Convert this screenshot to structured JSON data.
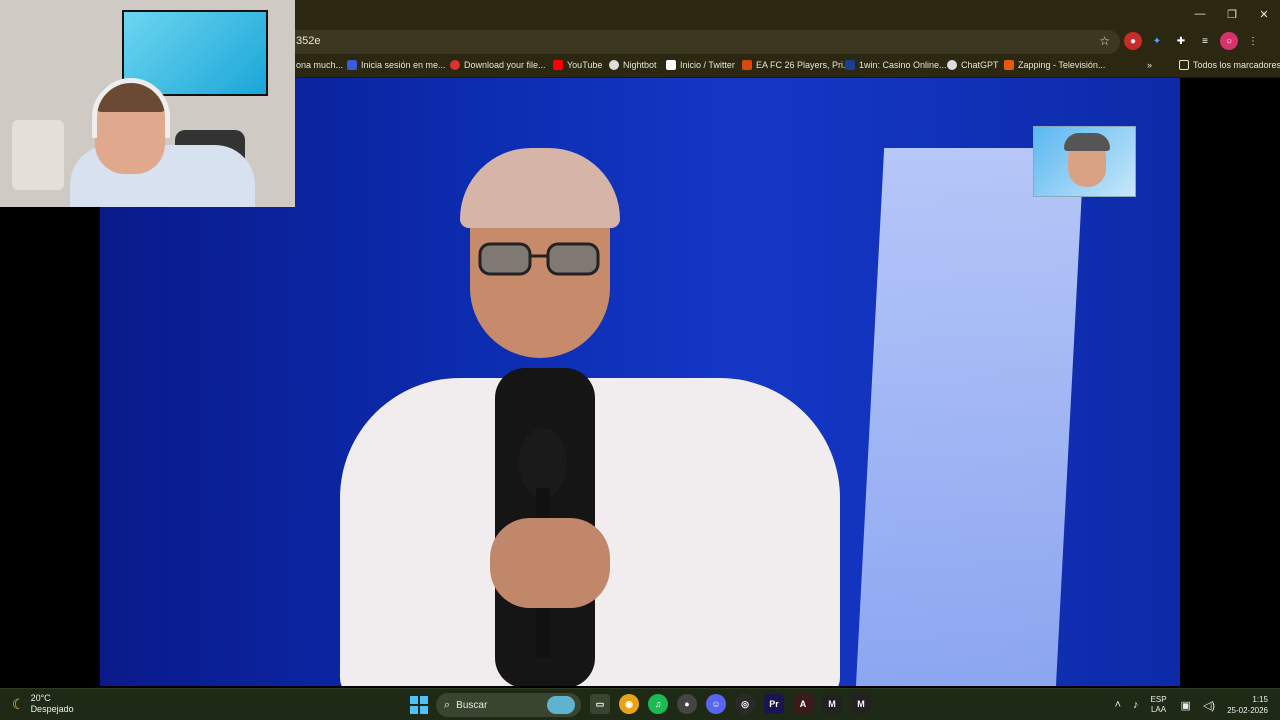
{
  "browser": {
    "url": "352e",
    "window_controls": {
      "minimize": "—",
      "restore": "❐",
      "close": "✕"
    },
    "bookmarks": [
      {
        "label": "ona much...",
        "icon": "page-icon",
        "color": "#2b2710"
      },
      {
        "label": "Inicia sesión en me...",
        "icon": "login-icon",
        "color": "#3b5bdb"
      },
      {
        "label": "Download your file...",
        "icon": "download-icon",
        "color": "#e03131"
      },
      {
        "label": "YouTube",
        "icon": "youtube-icon",
        "color": "#ff0000"
      },
      {
        "label": "Nightbot",
        "icon": "nightbot-icon",
        "color": "#dddddd"
      },
      {
        "label": "Inicio / Twitter",
        "icon": "x-icon",
        "color": "#ffffff"
      },
      {
        "label": "EA FC 26 Players, Pri...",
        "icon": "futbin-icon",
        "color": "#d9480f"
      },
      {
        "label": "1win: Casino Online...",
        "icon": "1win-icon",
        "color": "#1c3f94"
      },
      {
        "label": "ChatGPT",
        "icon": "chatgpt-icon",
        "color": "#dddddd"
      },
      {
        "label": "Zapping - Televisión...",
        "icon": "zapping-icon",
        "color": "#e8590c"
      }
    ],
    "bookmarks_overflow": "»",
    "all_bookmarks_label": "Todos los marcadores"
  },
  "taskbar": {
    "weather_temp": "20°C",
    "weather_desc": "Despejado",
    "search_label": "Buscar",
    "apps": [
      {
        "name": "file-explorer",
        "glyph": "▭",
        "color": "#3a4530"
      },
      {
        "name": "chrome",
        "glyph": "◉",
        "color": "#e8a317"
      },
      {
        "name": "spotify",
        "glyph": "♫",
        "color": "#1db954"
      },
      {
        "name": "obs",
        "glyph": "●",
        "color": "#444444"
      },
      {
        "name": "discord",
        "glyph": "☺",
        "color": "#5865f2"
      },
      {
        "name": "steam",
        "glyph": "◎",
        "color": "#2a2a2a"
      },
      {
        "name": "premiere",
        "glyph": "Pr",
        "color": "#1a1450"
      },
      {
        "name": "affinity",
        "glyph": "A",
        "color": "#3a1b1b"
      },
      {
        "name": "app-m1",
        "glyph": "M",
        "color": "#222222"
      },
      {
        "name": "app-m2",
        "glyph": "M",
        "color": "#222222"
      }
    ],
    "lang_top": "ESP",
    "lang_bottom": "LAA",
    "time": "1:15",
    "date": "25-02-2026"
  }
}
